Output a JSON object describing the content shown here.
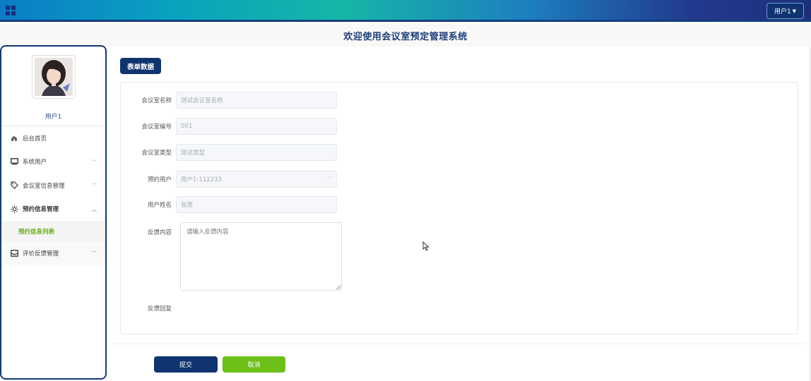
{
  "header": {
    "user_menu_label": "用户1"
  },
  "title": "欢迎使用会议室预定管理系统",
  "sidebar": {
    "username": "用户1",
    "items": [
      {
        "label": "后台首页",
        "icon": "home-icon"
      },
      {
        "label": "系统用户",
        "icon": "monitor-icon"
      },
      {
        "label": "会议室信息管理",
        "icon": "tag-icon"
      },
      {
        "label": "预约信息管理",
        "icon": "sun-icon"
      },
      {
        "label": "评价反馈管理",
        "icon": "inbox-icon"
      }
    ],
    "submenu_active": "预约信息列表"
  },
  "form": {
    "tag": "表单数据",
    "fields": [
      {
        "label": "会议室名称",
        "value": "测试会议室名称"
      },
      {
        "label": "会议室编号",
        "value": "001"
      },
      {
        "label": "会议室类型",
        "value": "测试类型"
      },
      {
        "label": "预约用户",
        "value": "用户1-112233"
      },
      {
        "label": "用户姓名",
        "value": "张思"
      }
    ],
    "feedback_label": "反馈内容",
    "feedback_placeholder": "请输入反馈内容",
    "reply_label": "反馈回复",
    "submit_label": "提交",
    "cancel_label": "取消"
  },
  "colors": {
    "primary": "#0f3470",
    "accent_green": "#6cc018",
    "title_text": "#1d3f7a"
  }
}
